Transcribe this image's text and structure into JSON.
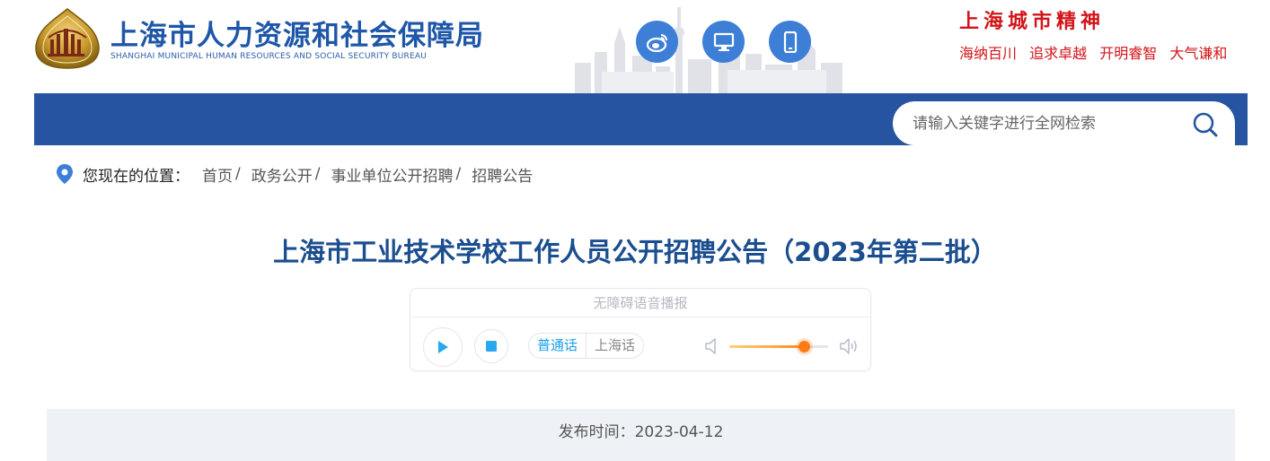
{
  "header": {
    "site_name": "上海市人力资源和社会保障局",
    "site_name_en": "SHANGHAI MUNICIPAL HUMAN RESOURCES AND SOCIAL SECURITY BUREAU",
    "icons": [
      "weibo-icon",
      "desktop-icon",
      "mobile-icon"
    ],
    "slogan_title": "上海城市精神",
    "slogan_items": [
      "海纳百川",
      "追求卓越",
      "开明睿智",
      "大气谦和"
    ]
  },
  "nav": {
    "search_placeholder": "请输入关键字进行全网检索"
  },
  "breadcrumb": {
    "label": "您现在的位置：",
    "items": [
      "首页",
      "政务公开",
      "事业单位公开招聘",
      "招聘公告"
    ],
    "separator": "/"
  },
  "article": {
    "title": "上海市工业技术学校工作人员公开招聘公告（2023年第二批）",
    "publish_label": "发布时间：",
    "publish_date": "2023-04-12"
  },
  "player": {
    "title": "无障碍语音播报",
    "languages": [
      "普通话",
      "上海话"
    ],
    "active_language": "普通话",
    "volume": 0.75
  },
  "colors": {
    "nav_blue": "#2654a0",
    "title_blue": "#1b4e8f",
    "slogan_red": "#d3141a",
    "accent_orange": "#ff7a12"
  }
}
